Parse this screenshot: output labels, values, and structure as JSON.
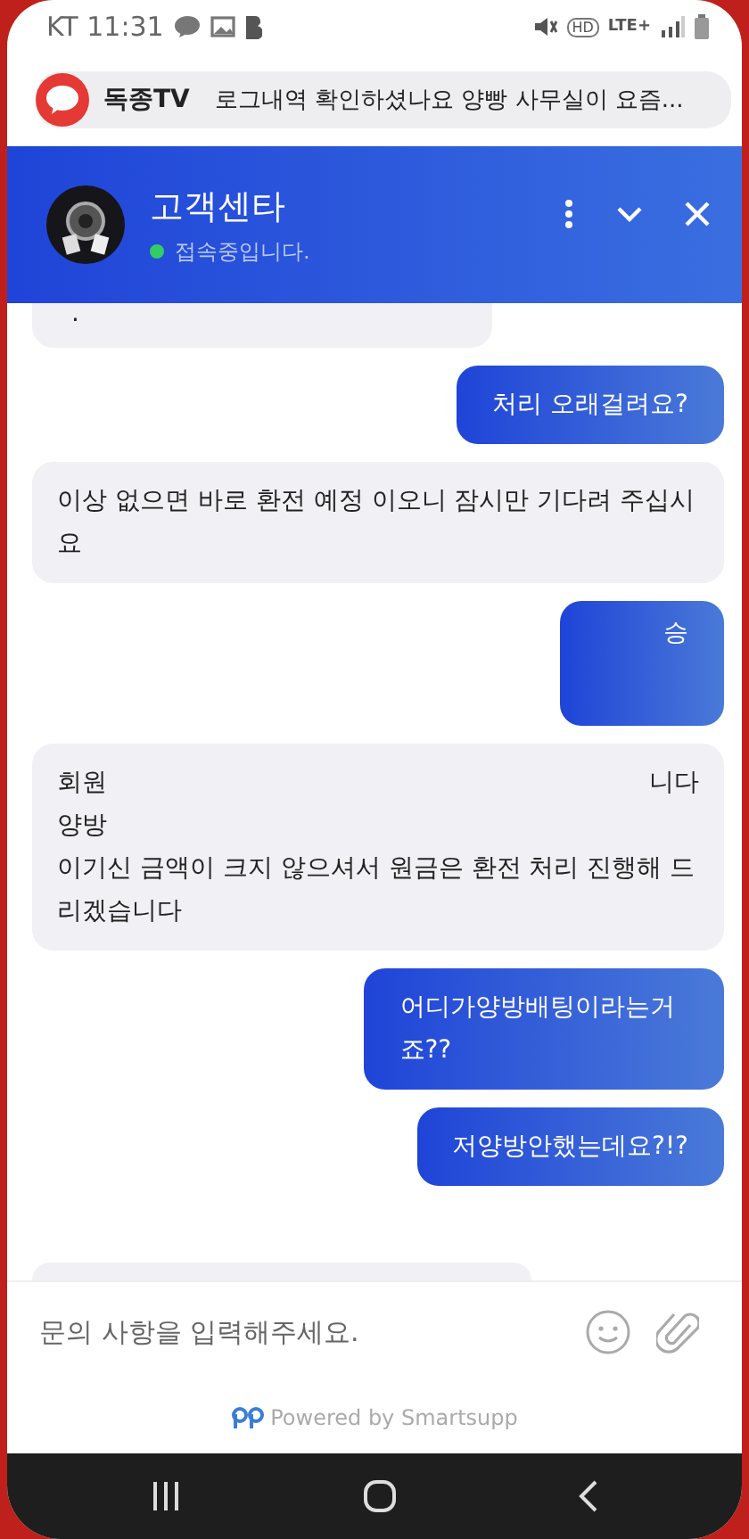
{
  "status_bar": {
    "carrier_time": "KT 11:31",
    "hd": "HD",
    "network": "LTE+"
  },
  "notification": {
    "app": "독종TV",
    "message": "로그내역 확인하셨나요 양빵 사무실이 요즘..."
  },
  "chat_header": {
    "title": "고객센타",
    "status": "접속중입니다.",
    "online": true
  },
  "messages": [
    {
      "kind": "agent_top",
      "lines": [
        {
          "parts": [
            "."
          ]
        }
      ]
    },
    {
      "kind": "user",
      "lines": [
        {
          "parts": [
            "처리 오래걸려요?"
          ]
        }
      ]
    },
    {
      "kind": "agent",
      "lines": [
        {
          "parts": [
            "이상 없으면 바로 환전 예정 이오니 잠시만 기다려 주십시요"
          ]
        }
      ]
    },
    {
      "kind": "user_tall",
      "lines": [
        {
          "parts": [
            "승"
          ]
        }
      ]
    },
    {
      "kind": "agent",
      "lines": [
        {
          "parts": [
            "회원",
            "니다"
          ]
        },
        {
          "parts": [
            "양방"
          ]
        },
        {
          "parts": [
            "이기신 금액이 크지 않으셔서 원금은 환전 처리 진행해 드리겠습니다"
          ]
        }
      ]
    },
    {
      "kind": "user",
      "lines": [
        {
          "parts": [
            "어디가양방배팅이라는거죠??"
          ]
        }
      ]
    },
    {
      "kind": "user",
      "lines": [
        {
          "parts": [
            "저양방안했는데요?!?"
          ]
        }
      ]
    },
    {
      "kind": "agent_stub"
    }
  ],
  "composer": {
    "placeholder": "문의 사항을 입력해주세요."
  },
  "footer": {
    "powered": "Powered by Smartsupp"
  }
}
